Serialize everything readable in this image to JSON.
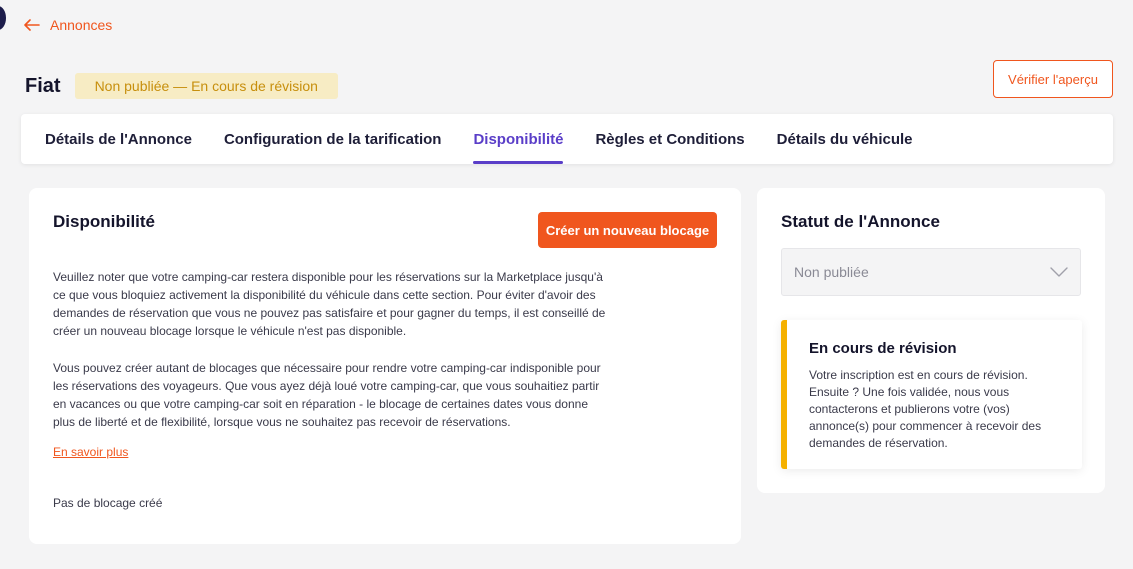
{
  "nav": {
    "back_label": "Annonces"
  },
  "header": {
    "title": "Fiat",
    "status_badge": "Non publiée — En cours de révision",
    "verify_button": "Vérifier l'aperçu"
  },
  "tabs": [
    {
      "label": "Détails de l'Annonce",
      "active": false
    },
    {
      "label": "Configuration de la tarification",
      "active": false
    },
    {
      "label": "Disponibilité",
      "active": true
    },
    {
      "label": "Règles et Conditions",
      "active": false
    },
    {
      "label": "Détails du véhicule",
      "active": false
    }
  ],
  "availability": {
    "title": "Disponibilité",
    "create_button": "Créer un nouveau blocage",
    "paragraph1": "Veuillez noter que votre camping-car restera disponible pour les réservations sur la Marketplace jusqu'à ce que vous bloquiez activement la disponibilité du véhicule dans cette section. Pour éviter d'avoir des demandes de réservation que vous ne pouvez pas satisfaire et pour gagner du temps, il est conseillé de créer un nouveau blocage lorsque le véhicule n'est pas disponible.",
    "paragraph2": "Vous pouvez créer autant de blocages que nécessaire pour rendre votre camping-car indisponible pour les réservations des voyageurs. Que vous ayez déjà loué votre camping-car, que vous souhaitiez partir en vacances ou que votre camping-car soit en réparation - le blocage de certaines dates vous donne plus de liberté et de flexibilité, lorsque vous ne souhaitez pas recevoir de réservations.",
    "learn_more": "En savoir plus",
    "empty_state": "Pas de blocage créé"
  },
  "listing_status": {
    "title": "Statut de l'Annonce",
    "selected_value": "Non publiée",
    "review_title": "En cours de révision",
    "review_text": "Votre inscription est en cours de révision. Ensuite ? Une fois validée, nous vous contacterons et publierons votre (vos) annonce(s) pour commencer à recevoir des demandes de réservation."
  },
  "colors": {
    "accent": "#f0561e",
    "active_tab": "#5a3ec8",
    "badge_bg": "#f7ecc4",
    "badge_text": "#c78f0d",
    "review_border": "#f5b100"
  },
  "icons": {
    "back": "arrow-left-icon",
    "select": "chevron-down-icon"
  }
}
